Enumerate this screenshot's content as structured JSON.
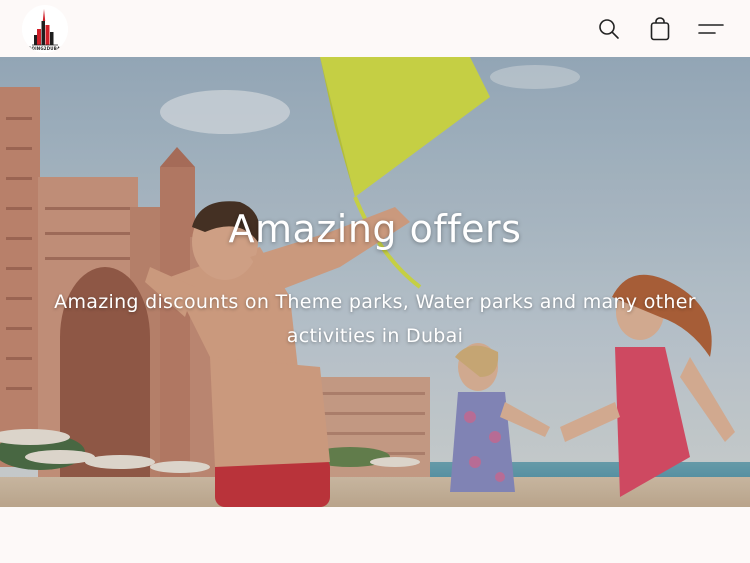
{
  "header": {
    "logo_text": "GOING2DUBAI",
    "icons": {
      "search": "search-icon",
      "cart": "shopping-bag-icon",
      "menu": "menu-icon"
    }
  },
  "hero": {
    "title": "Amazing offers",
    "subtitle": "Amazing discounts on Theme parks, Water parks and many other activities in Dubai"
  },
  "colors": {
    "page_background": "#fdf9f8",
    "logo_accent": "#d0202a",
    "icon_color": "#222222",
    "hero_text": "#ffffff"
  }
}
